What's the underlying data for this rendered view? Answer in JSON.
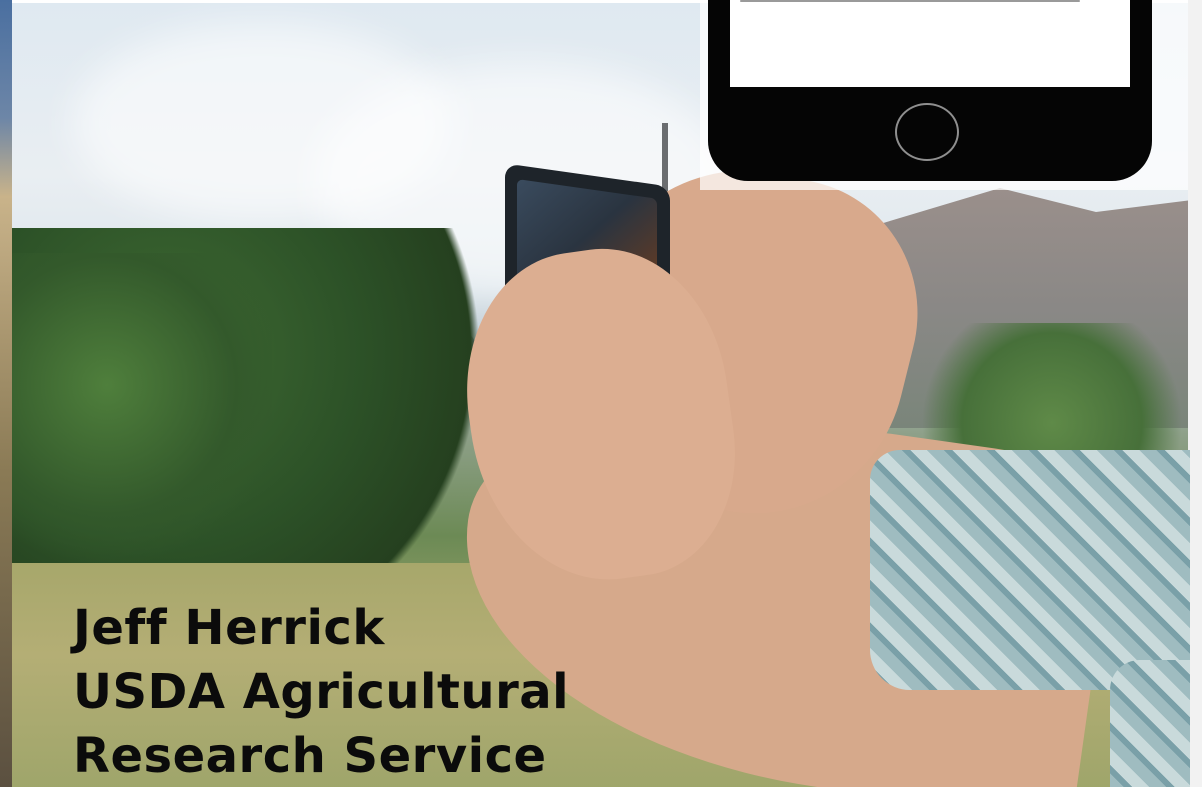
{
  "caption": {
    "line1": "Jeff Herrick",
    "line2": "USDA Agricultural",
    "line3": "Research Service"
  },
  "colors": {
    "caption_text": "#0b0b0b",
    "phone_body": "#050505",
    "phone_screen": "#ffffff"
  },
  "icons": {
    "home_button": "home-button-icon"
  }
}
